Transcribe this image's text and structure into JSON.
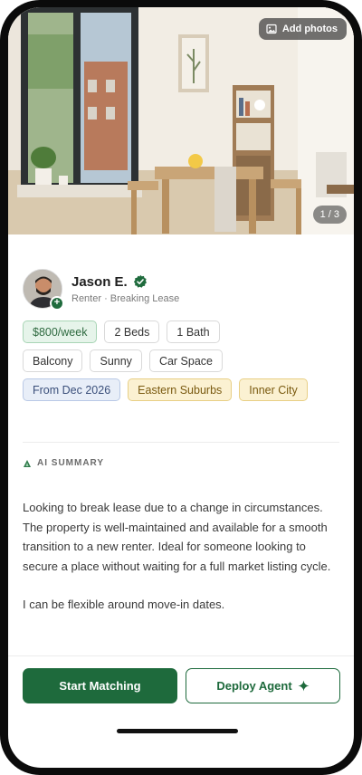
{
  "hero": {
    "add_photos_label": "Add photos",
    "photo_counter": "1 / 3"
  },
  "profile": {
    "name": "Jason E.",
    "role": "Renter · Breaking Lease"
  },
  "chips": {
    "row1": [
      "$800/week",
      "2 Beds",
      "1 Bath"
    ],
    "row2": [
      "Balcony",
      "Sunny",
      "Car Space"
    ],
    "row3": [
      "From Dec 2026",
      "Eastern Suburbs",
      "Inner City"
    ]
  },
  "ai_summary": {
    "label": "AI SUMMARY",
    "paragraph1": "Looking to break lease due to a change in circumstances. The property is well-maintained and available for a smooth transition to a new renter. Ideal for someone looking to secure a place without waiting for a full market listing cycle.",
    "paragraph2": "I can be flexible around move-in dates."
  },
  "actions": {
    "primary_label": "Start Matching",
    "secondary_label": "Deploy Agent"
  },
  "colors": {
    "brand_green": "#1e6a3c",
    "chip_green_bg": "#e6f4ea",
    "chip_blue_bg": "#e8eef8",
    "chip_amber_bg": "#fbf1d2"
  },
  "icons": {
    "add_photos": "image-icon",
    "verified": "verified-badge-icon",
    "avatar_add": "plus-icon",
    "ai": "sparkle-triangle-icon",
    "deploy": "sparkle-icon"
  }
}
